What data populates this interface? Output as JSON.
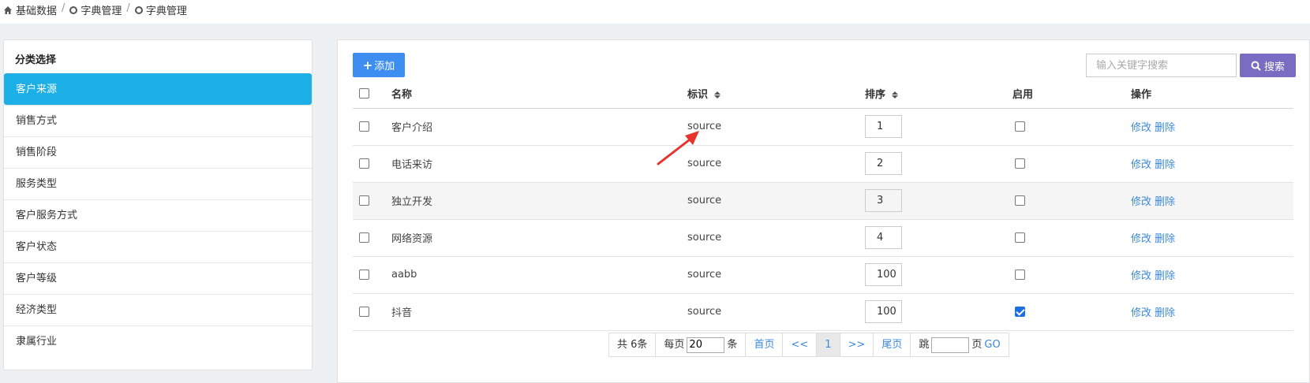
{
  "breadcrumb": {
    "home": "基础数据",
    "level2": "字典管理",
    "level3": "字典管理"
  },
  "sidebar": {
    "title": "分类选择",
    "items": [
      {
        "label": "客户来源"
      },
      {
        "label": "销售方式"
      },
      {
        "label": "销售阶段"
      },
      {
        "label": "服务类型"
      },
      {
        "label": "客户服务方式"
      },
      {
        "label": "客户状态"
      },
      {
        "label": "客户等级"
      },
      {
        "label": "经济类型"
      },
      {
        "label": "隶属行业"
      }
    ]
  },
  "toolbar": {
    "add_label": "添加",
    "search_placeholder": "输入关键字搜索",
    "search_label": "搜索"
  },
  "table": {
    "headers": {
      "name": "名称",
      "code": "标识",
      "order": "排序",
      "enabled": "启用",
      "ops": "操作"
    },
    "rows": [
      {
        "name": "客户介绍",
        "code": "source",
        "order": "1",
        "enabled": false
      },
      {
        "name": "电话来访",
        "code": "source",
        "order": "2",
        "enabled": false
      },
      {
        "name": "独立开发",
        "code": "source",
        "order": "3",
        "enabled": false
      },
      {
        "name": "网络资源",
        "code": "source",
        "order": "4",
        "enabled": false
      },
      {
        "name": "aabb",
        "code": "source",
        "order": "100",
        "enabled": false
      },
      {
        "name": "抖音",
        "code": "source",
        "order": "100",
        "enabled": true
      }
    ],
    "edit_label": "修改",
    "delete_label": "删除"
  },
  "pager": {
    "total": "共 6条",
    "per_page_prefix": "每页",
    "per_page_value": "20",
    "per_page_suffix": "条",
    "first": "首页",
    "prev": "<<",
    "current": "1",
    "next": ">>",
    "last": "尾页",
    "jump_prefix": "跳",
    "jump_suffix": "页",
    "go": "GO"
  },
  "colors": {
    "active_sidebar": "#1cb0e6",
    "add_button": "#3d8ef0",
    "search_button": "#7b6cc3",
    "link": "#3b88d8",
    "annotation_arrow": "#e8322c"
  }
}
